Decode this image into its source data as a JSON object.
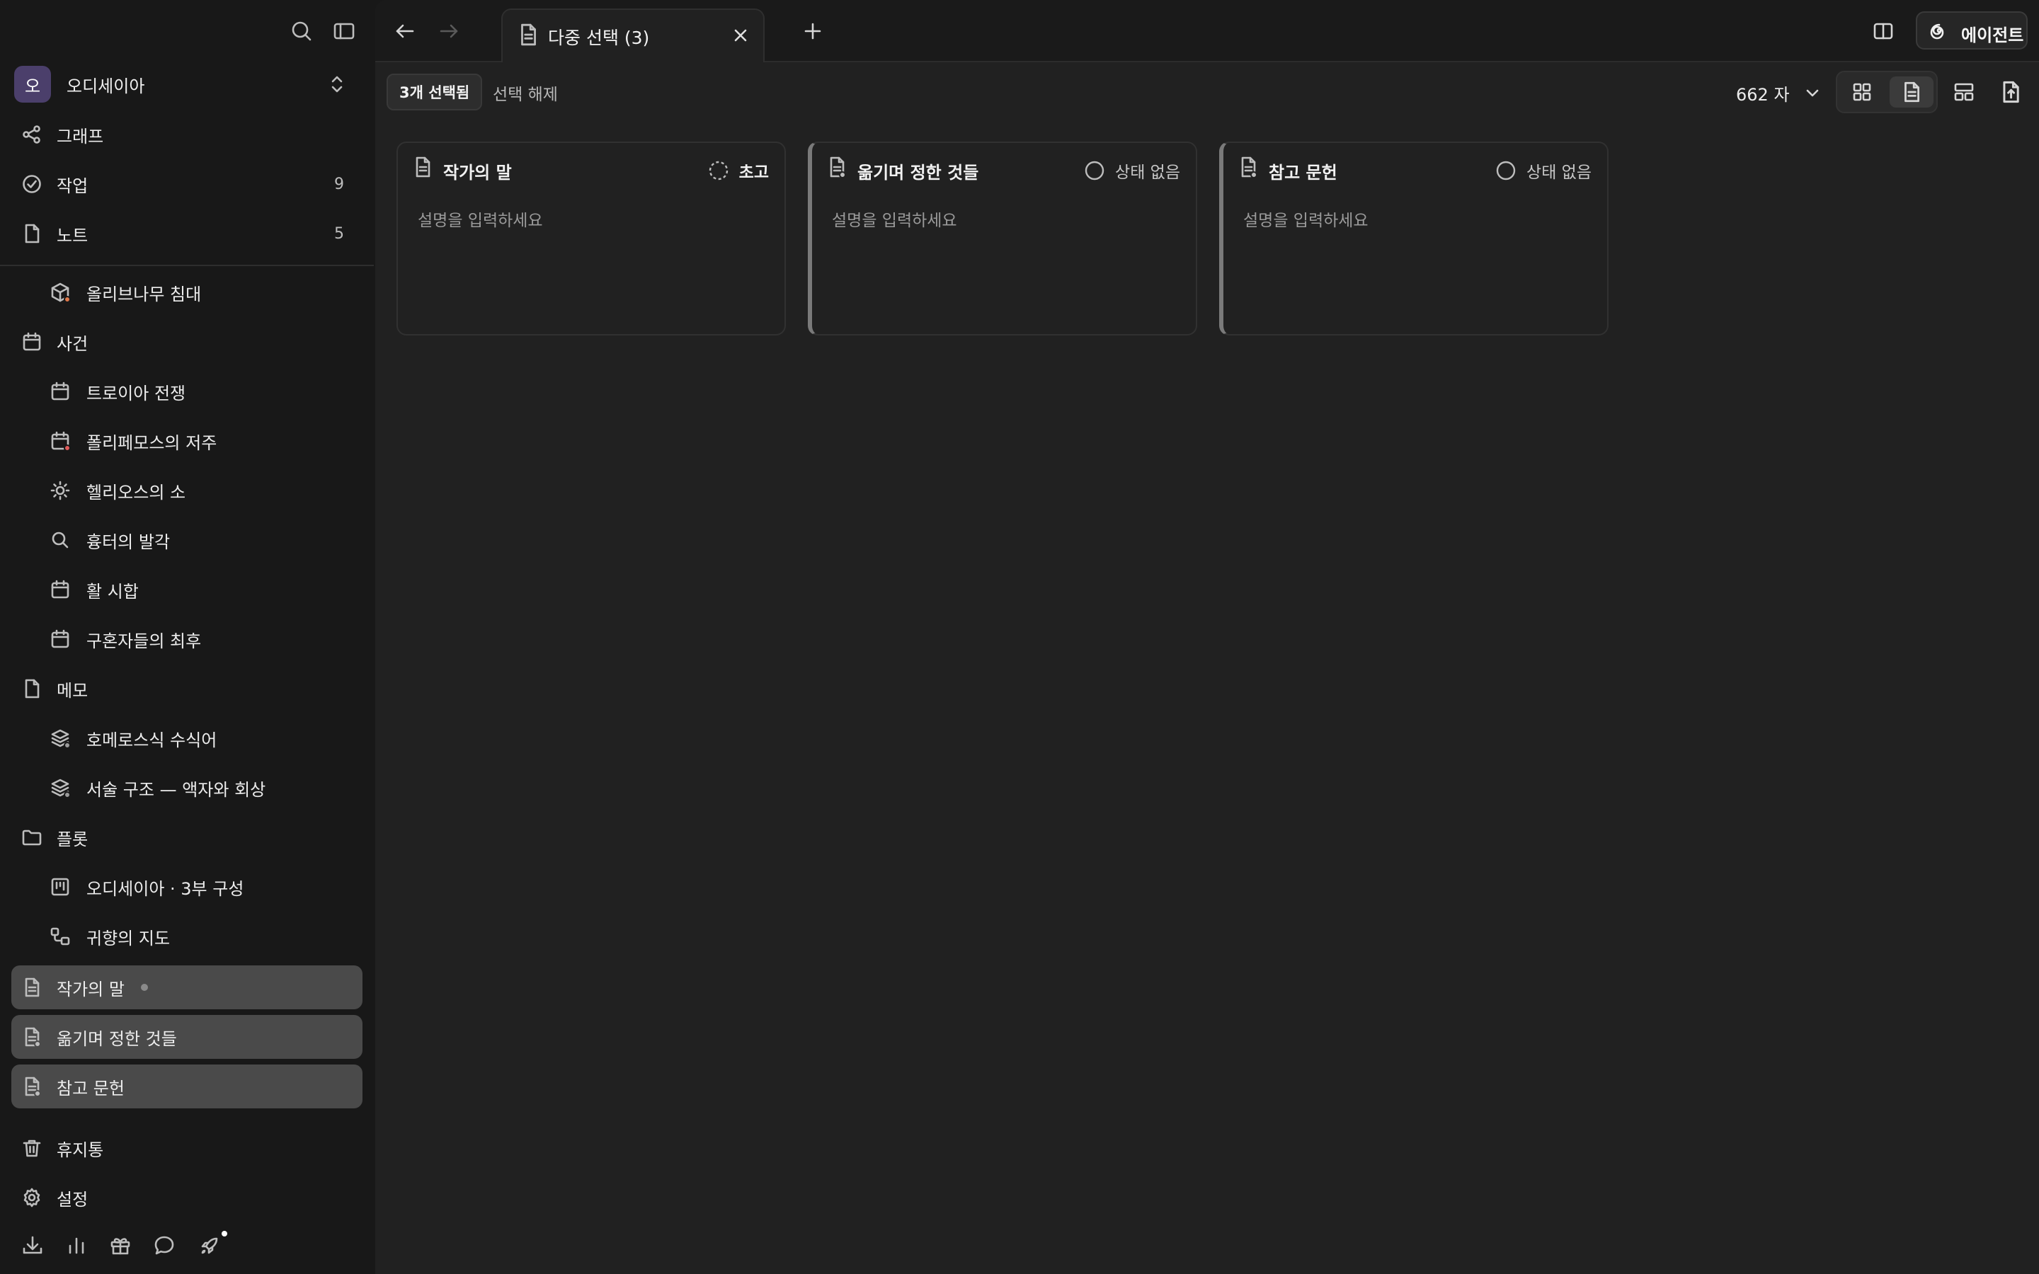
{
  "sidebar": {
    "workspace": {
      "avatar": "오",
      "name": "오디세이아",
      "avatar_color": "#4b3f6b"
    },
    "nav": [
      {
        "label": "그래프",
        "icon": "graph-icon"
      },
      {
        "label": "작업",
        "icon": "check-circle-icon",
        "count": "9"
      },
      {
        "label": "노트",
        "icon": "note-icon",
        "count": "5"
      }
    ],
    "tree": [
      {
        "label": "올리브나무 침대",
        "icon": "box-icon",
        "child": true,
        "badge": "#e0784a"
      },
      {
        "label": "사건",
        "icon": "calendar-icon",
        "child": false
      },
      {
        "label": "트로이아 전쟁",
        "icon": "calendar-icon",
        "child": true
      },
      {
        "label": "폴리페모스의 저주",
        "icon": "calendar-icon",
        "child": true,
        "badge": "#e05a5a"
      },
      {
        "label": "헬리오스의 소",
        "icon": "sun-icon",
        "child": true
      },
      {
        "label": "흉터의 발각",
        "icon": "search-icon",
        "child": true
      },
      {
        "label": "활 시합",
        "icon": "calendar-icon",
        "child": true
      },
      {
        "label": "구혼자들의 최후",
        "icon": "calendar-icon",
        "child": true
      },
      {
        "label": "메모",
        "icon": "note-icon",
        "child": false
      },
      {
        "label": "호메로스식 수식어",
        "icon": "layers-icon",
        "child": true,
        "badge": "#9a9a9a"
      },
      {
        "label": "서술 구조 — 액자와 회상",
        "icon": "layers-icon",
        "child": true,
        "badge": "#9a9a9a"
      },
      {
        "label": "플롯",
        "icon": "folder-icon",
        "child": false
      },
      {
        "label": "오디세이아 · 3부 구성",
        "icon": "kanban-icon",
        "child": true
      },
      {
        "label": "귀향의 지도",
        "icon": "flow-icon",
        "child": true
      }
    ],
    "selected": [
      {
        "label": "작가의 말",
        "icon": "document-icon"
      },
      {
        "label": "옮기며 정한 것들",
        "icon": "document-icon"
      },
      {
        "label": "참고 문헌",
        "icon": "document-icon"
      }
    ],
    "footer": [
      {
        "label": "휴지통",
        "icon": "trash-icon"
      },
      {
        "label": "설정",
        "icon": "gear-icon"
      }
    ],
    "bottom_icons": [
      "download-icon",
      "chart-icon",
      "gift-icon",
      "chat-icon",
      "rocket-icon"
    ]
  },
  "topbar": {
    "tab_title": "다중 선택 (3)",
    "agent_label": "에이전트"
  },
  "toolbar": {
    "selected_count": "3개 선택됨",
    "deselect": "선택 해제",
    "word_count": "662 자"
  },
  "cards": [
    {
      "title": "작가의 말",
      "status": "초고",
      "status_type": "draft",
      "description": "설명을 입력하세요"
    },
    {
      "title": "옮기며 정한 것들",
      "status": "상태 없음",
      "status_type": "none",
      "description": "설명을 입력하세요"
    },
    {
      "title": "참고 문헌",
      "status": "상태 없음",
      "status_type": "none",
      "description": "설명을 입력하세요"
    }
  ]
}
